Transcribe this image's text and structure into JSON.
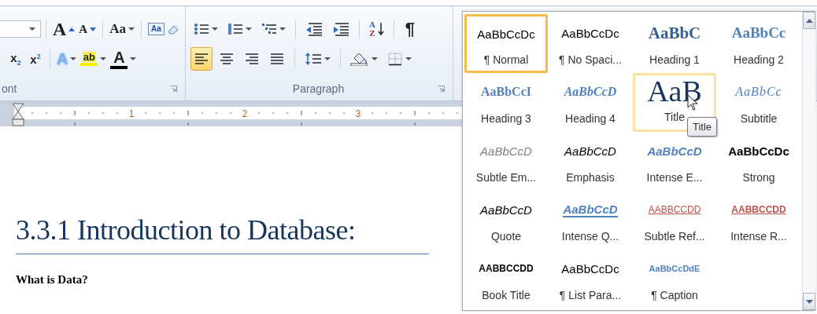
{
  "ribbon": {
    "groups": [
      {
        "label": "ont",
        "rows": [
          [
            [
              {
                "kind": "combo"
              }
            ],
            [
              {
                "kind": "grow",
                "text": "A"
              },
              {
                "kind": "shrink",
                "text": "A"
              }
            ],
            [
              {
                "kind": "case",
                "text": "Aa",
                "dropdown": true
              }
            ],
            [
              {
                "kind": "clear",
                "text": "Aa"
              }
            ]
          ],
          [
            [
              {
                "kind": "sub",
                "text": "x$_{2}$"
              },
              {
                "kind": "sup",
                "text": "x$^{2}$"
              }
            ],
            [
              {
                "kind": "effects",
                "text": "A",
                "dropdown": true
              },
              {
                "kind": "highlight",
                "text": "ab",
                "dropdown": true
              },
              {
                "kind": "fontcolor",
                "text": "A",
                "dropdown": true
              }
            ]
          ]
        ]
      },
      {
        "label": "Paragraph",
        "rows": [
          [
            [
              {
                "kind": "bullets",
                "dropdown": true
              },
              {
                "kind": "numbering",
                "dropdown": true
              },
              {
                "kind": "multilevel",
                "dropdown": true
              }
            ],
            [
              {
                "kind": "outdent"
              },
              {
                "kind": "indent"
              }
            ],
            [
              {
                "kind": "sort",
                "letters": [
                  "A",
                  "Z"
                ]
              }
            ],
            [
              {
                "kind": "pilcrow",
                "text": "¶"
              }
            ]
          ],
          [
            [
              {
                "kind": "alignleft",
                "selected": true
              },
              {
                "kind": "center",
                "selected": false
              },
              {
                "kind": "right",
                "selected": false
              },
              {
                "kind": "justify",
                "selected": false
              }
            ],
            [
              {
                "kind": "spacing",
                "dropdown": true
              }
            ],
            [
              {
                "kind": "shading",
                "dropdown": true
              },
              {
                "kind": "borders",
                "dropdown": true
              }
            ]
          ]
        ]
      }
    ]
  },
  "ruler": {
    "numbers": [
      "1",
      "2",
      "3"
    ]
  },
  "document": {
    "heading": "3.3.1 Introduction to Database:",
    "subheading": "What is Data?"
  },
  "styles_gallery": {
    "tooltip": "Title",
    "items": [
      {
        "kind": "normal",
        "preview": "AaBbCcDc",
        "label": "¶ Normal",
        "selected": true,
        "hovered": false
      },
      {
        "kind": "normal",
        "preview": "AaBbCcDc",
        "label": "¶ No Spaci...",
        "selected": false,
        "hovered": false
      },
      {
        "kind": "heading1",
        "preview": "AaBbC",
        "label": "Heading 1",
        "selected": false,
        "hovered": false
      },
      {
        "kind": "heading2",
        "preview": "AaBbCc",
        "label": "Heading 2",
        "selected": false,
        "hovered": false
      },
      {
        "kind": "heading3",
        "preview": "AaBbCcI",
        "label": "Heading 3",
        "selected": false,
        "hovered": false
      },
      {
        "kind": "heading4",
        "preview": "AaBbCcD",
        "label": "Heading 4",
        "selected": false,
        "hovered": false
      },
      {
        "kind": "title",
        "preview": "AaB",
        "label": "Title",
        "selected": false,
        "hovered": true
      },
      {
        "kind": "subtitle",
        "preview": "AaBbCc",
        "label": "Subtitle",
        "selected": false,
        "hovered": false
      },
      {
        "kind": "subtleemphasis",
        "preview": "AaBbCcD",
        "label": "Subtle Em...",
        "selected": false,
        "hovered": false
      },
      {
        "kind": "emphasis",
        "preview": "AaBbCcD",
        "label": "Emphasis",
        "selected": false,
        "hovered": false
      },
      {
        "kind": "intenseemphasis",
        "preview": "AaBbCcD",
        "label": "Intense E...",
        "selected": false,
        "hovered": false
      },
      {
        "kind": "strong",
        "preview": "AaBbCcDc",
        "label": "Strong",
        "selected": false,
        "hovered": false
      },
      {
        "kind": "emphasis",
        "preview": "AaBbCcD",
        "label": "Quote",
        "selected": false,
        "hovered": false
      },
      {
        "kind": "intensequote",
        "preview": "AaBbCcD",
        "label": "Intense Q...",
        "selected": false,
        "hovered": false
      },
      {
        "kind": "subtlereference",
        "preview": "AABBCCDD",
        "label": "Subtle Ref...",
        "selected": false,
        "hovered": false
      },
      {
        "kind": "intensereference",
        "preview": "AABBCCDD",
        "label": "Intense R...",
        "selected": false,
        "hovered": false
      },
      {
        "kind": "booktitle",
        "preview": "AABBCCDD",
        "label": "Book Title",
        "selected": false,
        "hovered": false
      },
      {
        "kind": "normal",
        "preview": "AaBbCcDc",
        "label": "¶ List Para...",
        "selected": false,
        "hovered": false
      },
      {
        "kind": "caption",
        "preview": "AaBbCcDdE",
        "label": "¶ Caption",
        "selected": false,
        "hovered": false
      }
    ]
  }
}
